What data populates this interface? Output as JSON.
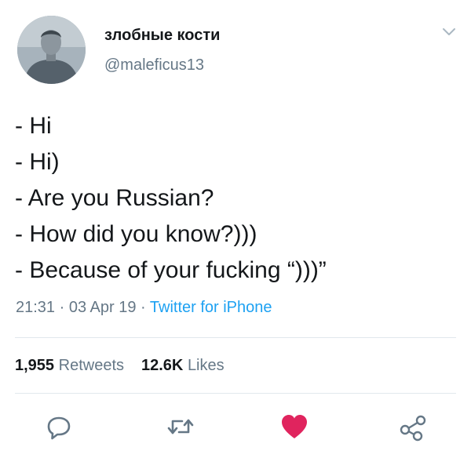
{
  "user": {
    "display_name": "злобные кости",
    "handle": "@maleficus13"
  },
  "tweet": {
    "lines": [
      "- Hi",
      "- Hi)",
      "- Are you Russian?",
      "- How did you know?)))",
      "- Because of your fucking “)))”"
    ],
    "time": "21:31",
    "date": "03 Apr 19",
    "separator": " · ",
    "source": "Twitter for iPhone"
  },
  "stats": {
    "retweets_count": "1,955",
    "retweets_label": "Retweets",
    "likes_count": "12.6K",
    "likes_label": "Likes"
  },
  "icons": {
    "chevron": "chevron-down-icon",
    "reply": "reply-icon",
    "retweet": "retweet-icon",
    "like": "heart-icon",
    "share": "share-icon"
  },
  "colors": {
    "text": "#14171a",
    "secondary": "#657786",
    "link": "#1da1f2",
    "like": "#e0245e",
    "divider": "#e1e8ed"
  }
}
